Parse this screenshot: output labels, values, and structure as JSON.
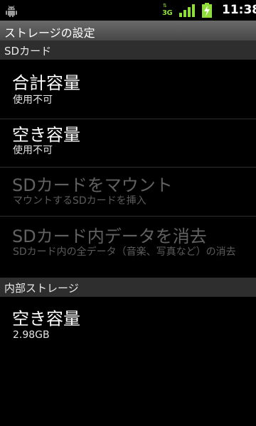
{
  "status_bar": {
    "time": "11:38",
    "network_label": "3G",
    "icons": [
      "android-icon",
      "3g-data-icon",
      "signal-icon",
      "battery-charging-icon"
    ],
    "accent_color": "#8fdc3b"
  },
  "title": "ストレージの設定",
  "sections": [
    {
      "header": "SDカード",
      "items": [
        {
          "title": "合計容量",
          "summary": "使用不可",
          "enabled": true
        },
        {
          "title": "空き容量",
          "summary": "使用不可",
          "enabled": true
        },
        {
          "title": "SDカードをマウント",
          "summary": "マウントするSDカードを挿入",
          "enabled": false
        },
        {
          "title": "SDカード内データを消去",
          "summary": "SDカード内の全データ（音楽、写真など）の消去",
          "enabled": false
        }
      ]
    },
    {
      "header": "内部ストレージ",
      "items": [
        {
          "title": "空き容量",
          "summary": "2.98GB",
          "enabled": true
        }
      ]
    }
  ]
}
